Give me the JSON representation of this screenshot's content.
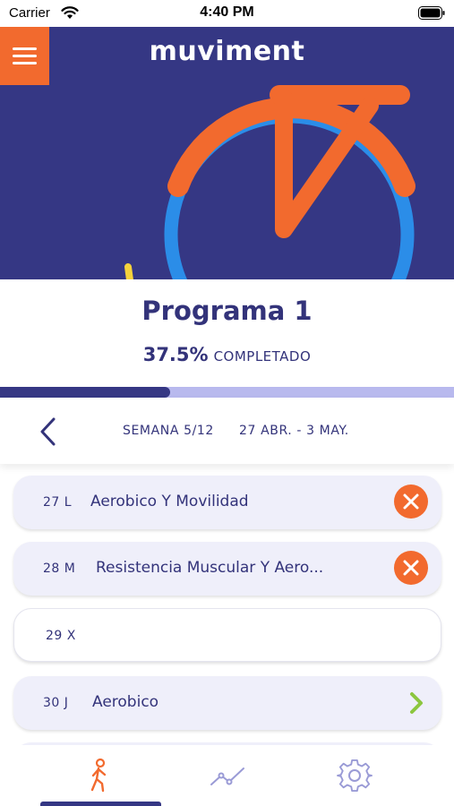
{
  "status_bar": {
    "carrier": "Carrier",
    "time": "4:40 PM",
    "wifi_icon": "wifi-icon",
    "battery_icon": "battery-icon"
  },
  "header": {
    "menu_icon": "hamburger-menu-icon",
    "logo_text": "muviment"
  },
  "program": {
    "title": "Programa 1",
    "progress_pct_text": "37.5%",
    "progress_label": "COMPLETADO",
    "progress_fraction": 0.375
  },
  "week_nav": {
    "back_icon": "chevron-left-icon",
    "week_label": "SEMANA 5/12",
    "date_range": "27 ABR. - 3 MAY."
  },
  "days": [
    {
      "date": "27 L",
      "title": "Aerobico Y Movilidad",
      "status": "missed",
      "status_icon": "close-circle-icon"
    },
    {
      "date": "28 M",
      "title": "Resistencia Muscular Y Aero...",
      "status": "missed",
      "status_icon": "close-circle-icon"
    },
    {
      "date": "29 X",
      "title": "",
      "status": "rest",
      "status_icon": ""
    },
    {
      "date": "30 J",
      "title": "Aerobico",
      "status": "pending",
      "status_icon": "chevron-right-icon"
    }
  ],
  "tabs": [
    {
      "name": "activity",
      "icon": "walking-person-icon",
      "active": true
    },
    {
      "name": "stats",
      "icon": "line-chart-icon",
      "active": false
    },
    {
      "name": "settings",
      "icon": "gear-icon",
      "active": false
    }
  ],
  "colors": {
    "brand_navy": "#353784",
    "brand_orange": "#f26a2e",
    "brand_blue": "#2b8de8",
    "brand_yellow": "#f5d23c",
    "progress_track": "#b8b9ee",
    "card_background": "#efeffa",
    "success_green": "#8cc63f"
  }
}
